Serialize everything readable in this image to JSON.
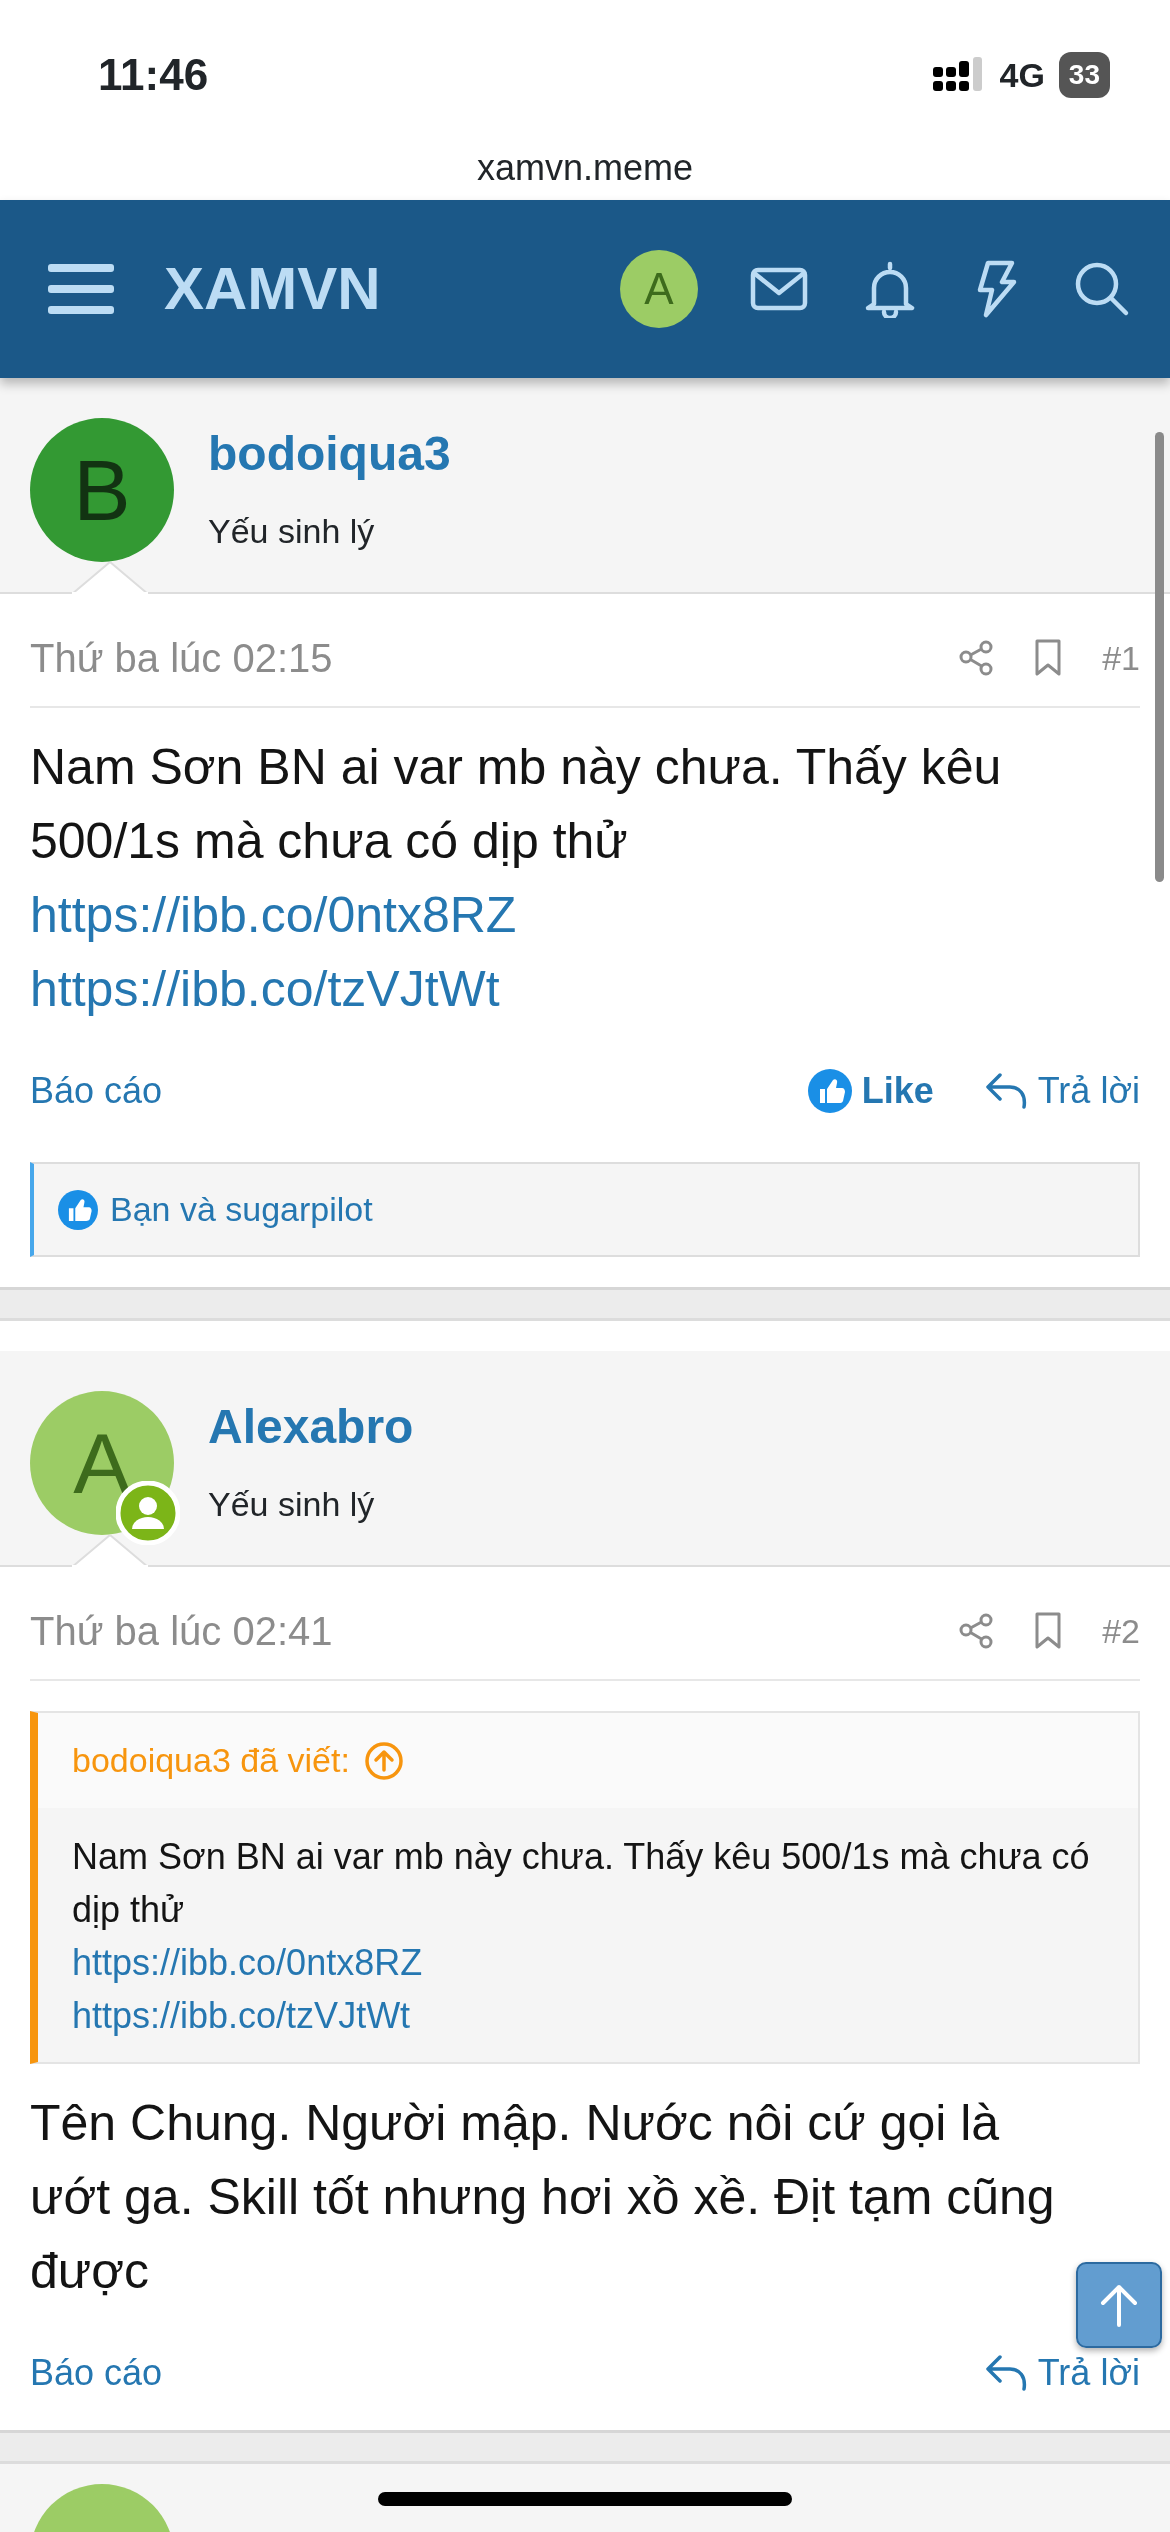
{
  "status_bar": {
    "time": "11:46",
    "network": "4G",
    "battery": "33"
  },
  "browser": {
    "url": "xamvn.meme"
  },
  "navbar": {
    "logo": "XAMVN",
    "avatar_letter": "A"
  },
  "posts": [
    {
      "author": "bodoiqua3",
      "avatar_letter": "B",
      "color": "#339933",
      "online": false,
      "user_title": "Yếu sinh lý",
      "date": "Thứ ba lúc 02:15",
      "number": "#1",
      "body": "Nam Sơn BN ai var mb này chưa. Thấy kêu 500/1s mà chưa có dịp thử",
      "links": [
        "https://ibb.co/0ntx8RZ",
        "https://ibb.co/tzVJtWt"
      ],
      "report": "Báo cáo",
      "like": {
        "label": "Like",
        "liked": true
      },
      "reply": "Trả lời",
      "reactions": "Bạn và sugarpilot"
    },
    {
      "author": "Alexabro",
      "avatar_letter": "A",
      "color": "#9ccc65",
      "online": true,
      "user_title": "Yếu sinh lý",
      "date": "Thứ ba lúc 02:41",
      "number": "#2",
      "quote": {
        "header": "bodoiqua3 đã viết:",
        "text": "Nam Sơn BN ai var mb này chưa. Thấy kêu 500/1s mà chưa có dịp thử",
        "links": [
          "https://ibb.co/0ntx8RZ",
          "https://ibb.co/tzVJtWt"
        ]
      },
      "body": "Tên Chung. Người mập. Nước nôi cứ gọi là ướt ga. Skill tốt nhưng hơi xồ xề. Địt tạm cũng được",
      "report": "Báo cáo",
      "reply": "Trả lời"
    }
  ],
  "next_post": {
    "color": "#9ccc65"
  }
}
